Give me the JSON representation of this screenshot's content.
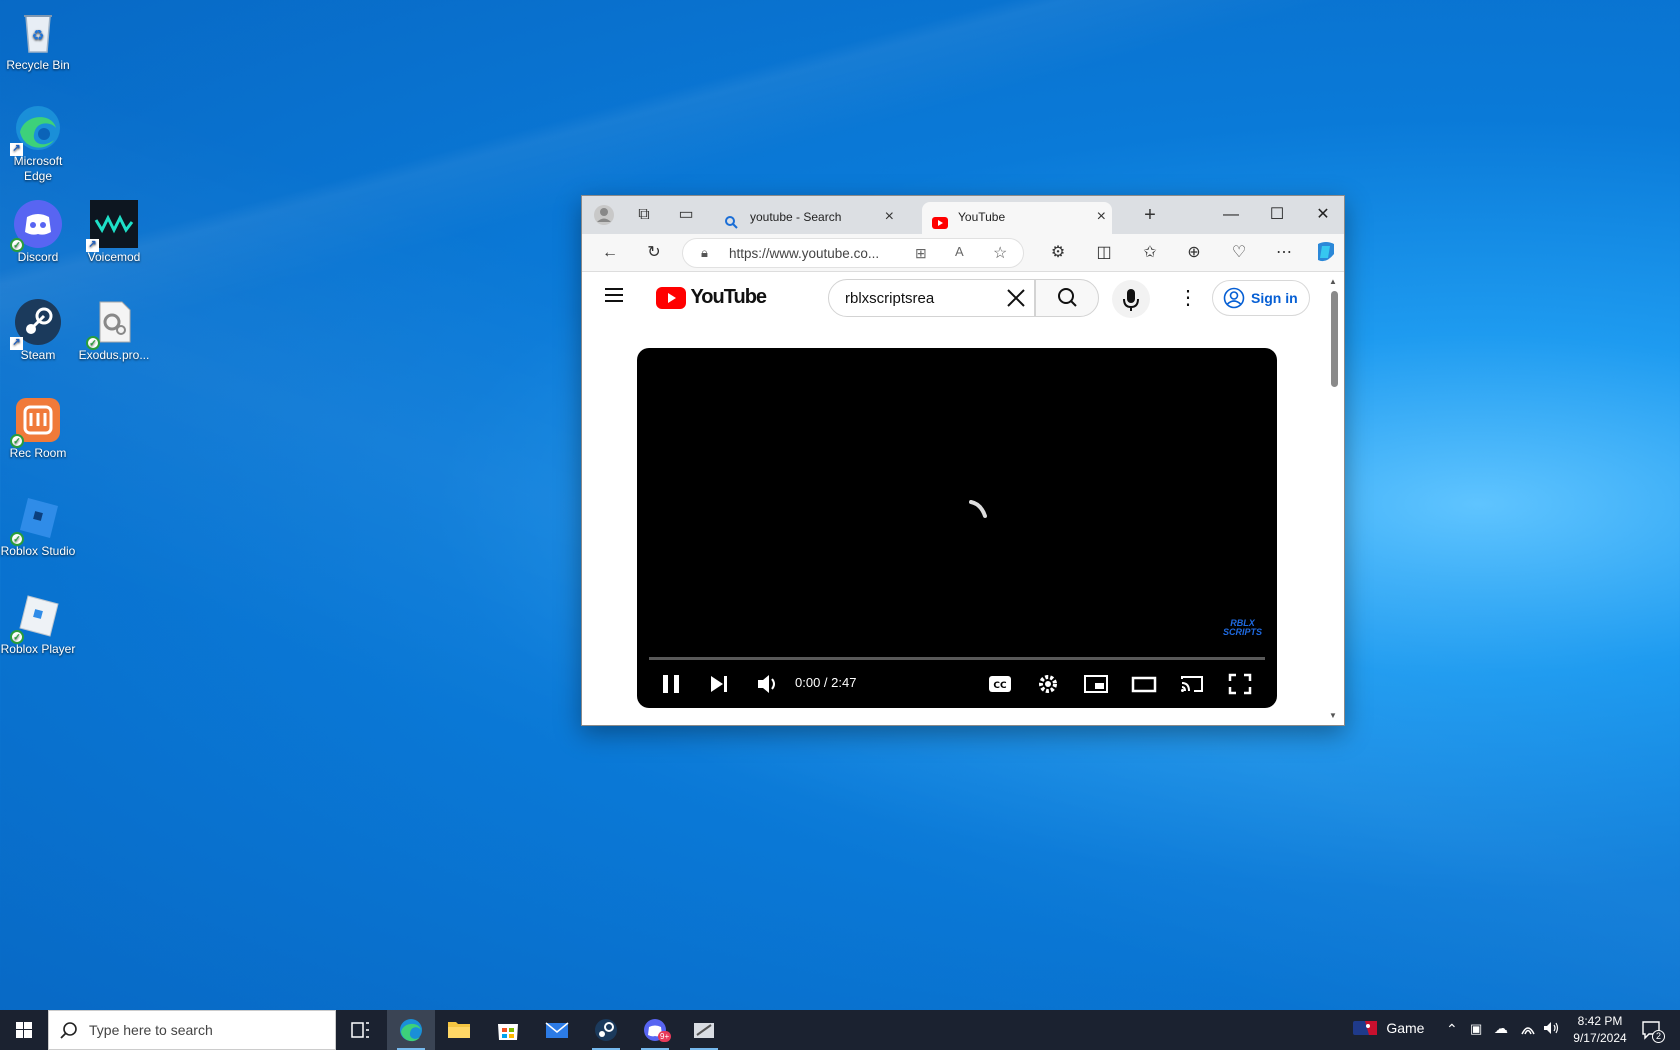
{
  "desktop": {
    "icons": [
      {
        "label": "Recycle Bin"
      },
      {
        "label": "Microsoft Edge"
      },
      {
        "label": "Discord"
      },
      {
        "label": "Voicemod"
      },
      {
        "label": "Steam"
      },
      {
        "label": "Exodus.pro..."
      },
      {
        "label": "Rec Room"
      },
      {
        "label": "Roblox Studio"
      },
      {
        "label": "Roblox Player"
      }
    ]
  },
  "browser": {
    "tabs": [
      {
        "title": "youtube - Search"
      },
      {
        "title": "YouTube"
      }
    ],
    "url": "https://www.youtube.co..."
  },
  "youtube": {
    "logo": "YouTube",
    "search_value": "rblxscriptsrea",
    "signin_label": "Sign in",
    "player": {
      "time": "0:00 / 2:47",
      "progress": 0,
      "watermark_line1": "RBLX",
      "watermark_line2": "SCRIPTS"
    }
  },
  "taskbar": {
    "search_placeholder": "Type here to search",
    "discord_badge": "9+",
    "game_label": "Game",
    "clock_time": "8:42 PM",
    "clock_date": "9/17/2024",
    "notification_count": "2"
  },
  "colors": {
    "accent": "#065fd4",
    "youtube_red": "#ff0000",
    "load_bar": "#e1292a",
    "taskbar": "#1b2230"
  }
}
